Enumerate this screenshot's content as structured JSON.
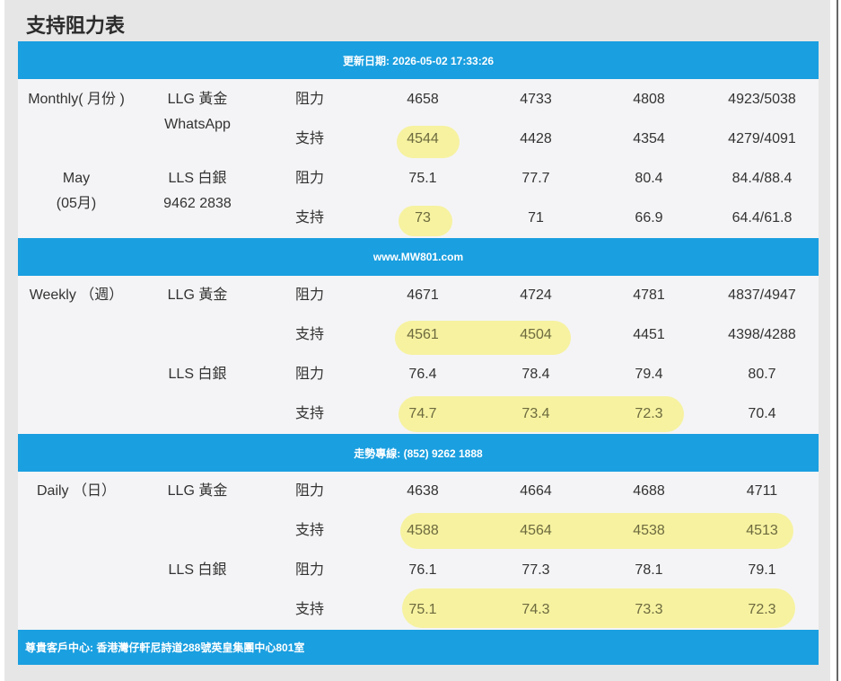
{
  "title": "支持阻力表",
  "header_bar": "更新日期: 2026-05-02 17:33:26",
  "mid_bar_1": "www.MW801.com",
  "mid_bar_2": "走勢專線: (852) 9262 1888",
  "footer_bar": "尊貴客戶中心: 香港灣仔軒尼詩道288號英皇集團中心801室",
  "monthly": {
    "period": "Monthly( 月份 )",
    "sub1": "May",
    "sub2": "(05月)",
    "llg_label": "LLG 黃金",
    "llg_sub": "WhatsApp",
    "lls_label": "LLS 白銀",
    "lls_sub": "9462 2838",
    "rows": [
      {
        "type": "阻力",
        "v": [
          "4658",
          "4733",
          "4808",
          "4923/5038"
        ]
      },
      {
        "type": "支持",
        "v": [
          "4544",
          "4428",
          "4354",
          "4279/4091"
        ]
      },
      {
        "type": "阻力",
        "v": [
          "75.1",
          "77.7",
          "80.4",
          "84.4/88.4"
        ]
      },
      {
        "type": "支持",
        "v": [
          "73",
          "71",
          "66.9",
          "64.4/61.8"
        ]
      }
    ]
  },
  "weekly": {
    "period": "Weekly （週）",
    "llg_label": "LLG 黃金",
    "lls_label": "LLS 白銀",
    "rows": [
      {
        "type": "阻力",
        "v": [
          "4671",
          "4724",
          "4781",
          "4837/4947"
        ]
      },
      {
        "type": "支持",
        "v": [
          "4561",
          "4504",
          "4451",
          "4398/4288"
        ]
      },
      {
        "type": "阻力",
        "v": [
          "76.4",
          "78.4",
          "79.4",
          "80.7"
        ]
      },
      {
        "type": "支持",
        "v": [
          "74.7",
          "73.4",
          "72.3",
          "70.4"
        ]
      }
    ]
  },
  "daily": {
    "period": "Daily （日）",
    "llg_label": "LLG 黃金",
    "lls_label": "LLS 白銀",
    "rows": [
      {
        "type": "阻力",
        "v": [
          "4638",
          "4664",
          "4688",
          "4711"
        ]
      },
      {
        "type": "支持",
        "v": [
          "4588",
          "4564",
          "4538",
          "4513"
        ]
      },
      {
        "type": "阻力",
        "v": [
          "76.1",
          "77.3",
          "78.1",
          "79.1"
        ]
      },
      {
        "type": "支持",
        "v": [
          "75.1",
          "74.3",
          "73.3",
          "72.3"
        ]
      }
    ]
  },
  "colors": {
    "bar": "#1a9fe0",
    "highlight": "#f6f2a0",
    "panel": "#e6e6e6"
  }
}
